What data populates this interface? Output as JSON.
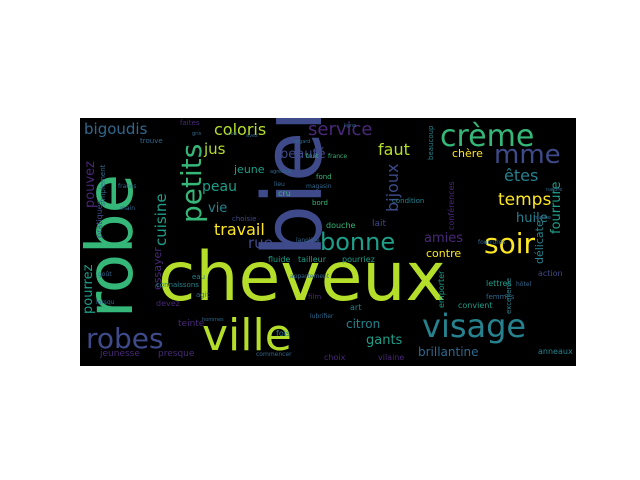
{
  "palette": {
    "background": "#000000",
    "lime": "#b5de2b",
    "yellow": "#fde725",
    "green": "#35b779",
    "teal": "#1f9e89",
    "cyan": "#26828e",
    "blue": "#3e4a89",
    "steel": "#31688e",
    "purple": "#482878",
    "dark": "#440154"
  },
  "words": {
    "cheveux": "cheveux",
    "bien": "bien",
    "robe": "robe",
    "ville": "ville",
    "visage": "visage",
    "soir": "soir",
    "creme": "crème",
    "petits": "petits",
    "robes": "robes",
    "bonne": "bonne",
    "mme": "mme",
    "bigoudis": "bigoudis",
    "service": "service",
    "coloris": "coloris",
    "travail": "travail",
    "temps": "temps",
    "faut": "faut",
    "bijoux": "bijoux",
    "etes": "êtes",
    "fourrure": "fourrure",
    "jus": "jus",
    "peau": "peau",
    "beaute": "beauté",
    "cuisine": "cuisine",
    "vie": "vie",
    "rue": "rue",
    "pourrez": "pourrez",
    "pouvez": "pouvez",
    "amies": "amies",
    "huile": "huile",
    "gants": "gants",
    "brillantine": "brillantine",
    "citron": "citron",
    "contre": "contre",
    "chere": "chère",
    "delicate": "délicate",
    "jeune": "jeune",
    "essayer": "essayer",
    "lait": "lait",
    "douche": "douche",
    "pourriez": "pourriez",
    "tailleur": "tailleur",
    "fluide": "fluide",
    "connaissons": "connaissons",
    "teinte": "teinte",
    "presque": "presque",
    "jeunesse": "jeunesse",
    "devez": "devez",
    "pratiques": "pratiques",
    "anneaux": "anneaux",
    "vilaine": "vilaine",
    "choix": "choix",
    "lettres": "lettres",
    "action": "action",
    "convient": "convient",
    "emporter": "emporter",
    "conferences": "conférences",
    "condition": "condition",
    "fond": "fond",
    "fois": "fois",
    "cru": "cru",
    "bord": "bord",
    "agit": "agit",
    "trouve": "trouve",
    "faites": "faites",
    "simplement": "simplement",
    "choisie": "choisie",
    "appartement": "appartement",
    "art": "art",
    "film": "film",
    "femmes": "femmes",
    "excellente": "excellente",
    "beaucoup": "beaucoup",
    "lanoline": "lanoline",
    "lieu": "lieu",
    "magasin": "magasin",
    "fruit": "fruit",
    "france": "france",
    "francs": "francs",
    "commencer": "commencer",
    "lubrifier": "lubrifier",
    "fourrures": "fourrures",
    "eau": "eau",
    "lorsqu": "lorsqu",
    "main": "main",
    "goût": "goût",
    "hommes": "hommes",
    "hotel": "hôtel",
    "maline": "maline",
    "gris": "gris",
    "avez": "avez",
    "ligne": "ligne",
    "nature": "nature",
    "regard": "regard",
    "agréable": "agréable",
    "cou": "cou"
  }
}
